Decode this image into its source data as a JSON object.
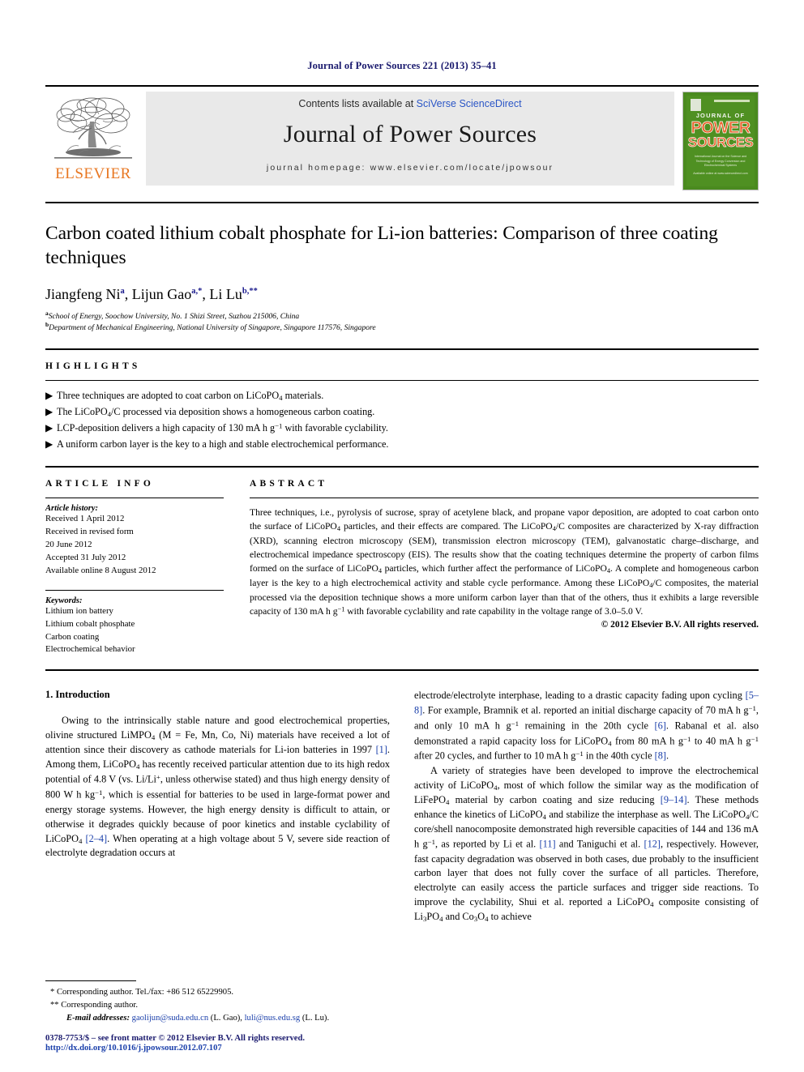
{
  "running_head": "Journal of Power Sources 221 (2013) 35–41",
  "masthead": {
    "publisher_name": "ELSEVIER",
    "contents_prefix": "Contents lists available at ",
    "contents_link": "SciVerse ScienceDirect",
    "journal_title": "Journal of Power Sources",
    "homepage": "journal homepage: www.elsevier.com/locate/jpowsour",
    "cover": {
      "line1": "JOURNAL OF",
      "line2": "POWER",
      "line3": "SOURCES",
      "subtitle": "International Journal on the Science and Technology of Energy Conversion and Electrochemical Systems",
      "footer": "Available online at www.sciencedirect.com"
    }
  },
  "article": {
    "title": "Carbon coated lithium cobalt phosphate for Li-ion batteries: Comparison of three coating techniques",
    "authors": [
      {
        "name": "Jiangfeng Ni",
        "marks": "a"
      },
      {
        "name": "Lijun Gao",
        "marks": "a,*"
      },
      {
        "name": "Li Lu",
        "marks": "b,**"
      }
    ],
    "affiliations": [
      {
        "mark": "a",
        "text": "School of Energy, Soochow University, No. 1 Shizi Street, Suzhou 215006, China"
      },
      {
        "mark": "b",
        "text": "Department of Mechanical Engineering, National University of Singapore, Singapore 117576, Singapore"
      }
    ]
  },
  "highlights": {
    "heading": "HIGHLIGHTS",
    "items": [
      "Three techniques are adopted to coat carbon on LiCoPO4 materials.",
      "The LiCoPO4/C processed via deposition shows a homogeneous carbon coating.",
      "LCP-deposition delivers a high capacity of 130 mA h g-1 with favorable cyclability.",
      "A uniform carbon layer is the key to a high and stable electrochemical performance."
    ]
  },
  "article_info": {
    "heading": "ARTICLE INFO",
    "history_label": "Article history:",
    "history": [
      "Received 1 April 2012",
      "Received in revised form",
      "20 June 2012",
      "Accepted 31 July 2012",
      "Available online 8 August 2012"
    ],
    "keywords_label": "Keywords:",
    "keywords": [
      "Lithium ion battery",
      "Lithium cobalt phosphate",
      "Carbon coating",
      "Electrochemical behavior"
    ]
  },
  "abstract": {
    "heading": "ABSTRACT",
    "text": "Three techniques, i.e., pyrolysis of sucrose, spray of acetylene black, and propane vapor deposition, are adopted to coat carbon onto the surface of LiCoPO4 particles, and their effects are compared. The LiCoPO4/C composites are characterized by X-ray diffraction (XRD), scanning electron microscopy (SEM), transmission electron microscopy (TEM), galvanostatic charge–discharge, and electrochemical impedance spectroscopy (EIS). The results show that the coating techniques determine the property of carbon films formed on the surface of LiCoPO4 particles, which further affect the performance of LiCoPO4. A complete and homogeneous carbon layer is the key to a high electrochemical activity and stable cycle performance. Among these LiCoPO4/C composites, the material processed via the deposition technique shows a more uniform carbon layer than that of the others, thus it exhibits a large reversible capacity of 130 mA h g-1 with favorable cyclability and rate capability in the voltage range of 3.0–5.0 V.",
    "copyright": "© 2012 Elsevier B.V. All rights reserved."
  },
  "body": {
    "section_heading": "1. Introduction",
    "left_paragraphs": [
      "Owing to the intrinsically stable nature and good electrochemical properties, olivine structured LiMPO4 (M = Fe, Mn, Co, Ni) materials have received a lot of attention since their discovery as cathode materials for Li-ion batteries in 1997 [1]. Among them, LiCoPO4 has recently received particular attention due to its high redox potential of 4.8 V (vs. Li/Li+, unless otherwise stated) and thus high energy density of 800 W h kg-1, which is essential for batteries to be used in large-format power and energy storage systems. However, the high energy density is difficult to attain, or otherwise it degrades quickly because of poor kinetics and instable cyclability of LiCoPO4 [2–4]. When operating at a high voltage about 5 V, severe side reaction of electrolyte degradation occurs at"
    ],
    "right_paragraphs": [
      "electrode/electrolyte interphase, leading to a drastic capacity fading upon cycling [5–8]. For example, Bramnik et al. reported an initial discharge capacity of 70 mA h g-1, and only 10 mA h g-1 remaining in the 20th cycle [6]. Rabanal et al. also demonstrated a rapid capacity loss for LiCoPO4 from 80 mA h g-1 to 40 mA h g-1 after 20 cycles, and further to 10 mA h g-1 in the 40th cycle [8].",
      "A variety of strategies have been developed to improve the electrochemical activity of LiCoPO4, most of which follow the similar way as the modification of LiFePO4 material by carbon coating and size reducing [9–14]. These methods enhance the kinetics of LiCoPO4 and stabilize the interphase as well. The LiCoPO4/C core/shell nanocomposite demonstrated high reversible capacities of 144 and 136 mA h g-1, as reported by Li et al. [11] and Taniguchi et al. [12], respectively. However, fast capacity degradation was observed in both cases, due probably to the insufficient carbon layer that does not fully cover the surface of all particles. Therefore, electrolyte can easily access the particle surfaces and trigger side reactions. To improve the cyclability, Shui et al. reported a LiCoPO4 composite consisting of Li3PO4 and Co3O4 to achieve"
    ]
  },
  "footnotes": {
    "corresponding_1": "* Corresponding author. Tel./fax: +86 512 65229905.",
    "corresponding_2": "** Corresponding author.",
    "email_label": "E-mail addresses:",
    "email_1": "gaolijun@suda.edu.cn",
    "email_1_who": "(L. Gao),",
    "email_2": "luli@nus.edu.sg",
    "email_2_who": "(L. Lu)."
  },
  "colophon": {
    "issn_line": "0378-7753/$ – see front matter © 2012 Elsevier B.V. All rights reserved.",
    "doi_line": "http://dx.doi.org/10.1016/j.jpowsour.2012.07.107"
  },
  "colors": {
    "link_blue": "#2b56c6",
    "ref_blue": "#1a3faa",
    "elsevier_orange": "#E87722",
    "cover_green": "#4f9022",
    "running_head_navy": "#1a1a6e"
  }
}
